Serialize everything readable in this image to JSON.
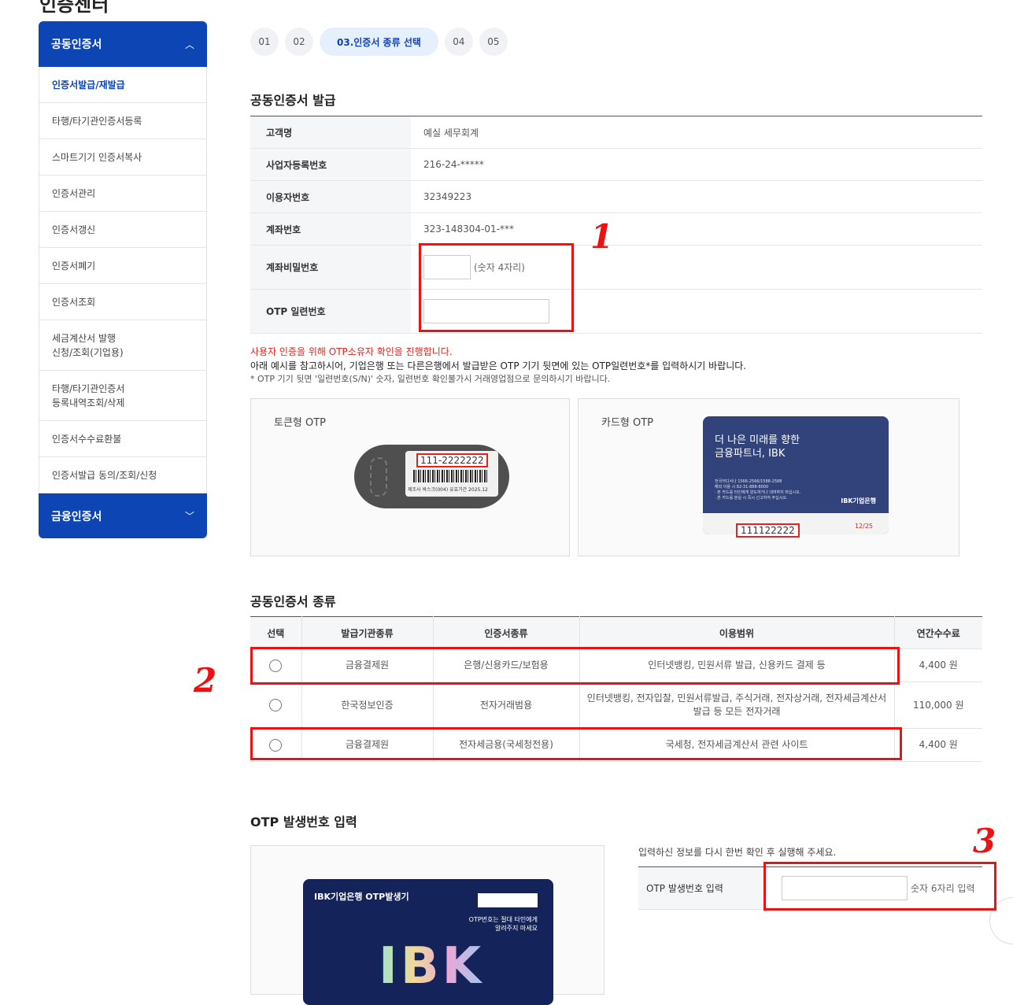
{
  "page_title": "인증센터",
  "sidebar": {
    "header": "공동인증서",
    "items": [
      {
        "label": "인증서발급/재발급",
        "active": true
      },
      {
        "label": "타행/타기관인증서등록"
      },
      {
        "label": "스마트기기 인증서복사"
      },
      {
        "label": "인증서관리"
      },
      {
        "label": "인증서갱신"
      },
      {
        "label": "인증서폐기"
      },
      {
        "label": "인증서조회"
      },
      {
        "label": "세금계산서 발행\n신청/조회(기업용)"
      },
      {
        "label": "타행/타기관인증서\n등록내역조회/삭제"
      },
      {
        "label": "인증서수수료환불"
      },
      {
        "label": "인증서발급 동의/조회/신청"
      }
    ],
    "footer": "금융인증서"
  },
  "steps": [
    "01",
    "02",
    "03.인증서 종류 선택",
    "04",
    "05"
  ],
  "issue_section": {
    "title": "공동인증서 발급",
    "rows": [
      {
        "label": "고객명",
        "value": "예실 세무회계"
      },
      {
        "label": "사업자등록번호",
        "value": "216-24-*****"
      },
      {
        "label": "이용자번호",
        "value": "32349223"
      },
      {
        "label": "계좌번호",
        "value": "323-148304-01-***"
      }
    ],
    "password_label": "계좌비밀번호",
    "password_hint": "(숫자 4자리)",
    "otp_serial_label": "OTP 일련번호"
  },
  "notice": {
    "red": "사용자 인증을 위해 OTP소유자 확인을 진행합니다.",
    "main": "아래 예시를 참고하시어, 기업은행 또는 다른은행에서 발급받은 OTP 기기 뒷면에 있는 OTP일련번호*를 입력하시기 바랍니다.",
    "small": "* OTP 기기 뒷면 '일련번호(S/N)' 숫자, 일련번호 확인불가시 거래영업점으로 문의하시기 바랍니다."
  },
  "token_otp": {
    "label": "토큰형 OTP",
    "serial": "111-2222222",
    "caption": "제조사 바스크(004) 유효기간 2025.12"
  },
  "card_otp": {
    "label": "카드형 OTP",
    "title_line1": "더 나은 미래를 향한",
    "title_line2": "금융파트너, IBK",
    "fine1": "전국어디서나 1566-2566/1588-2588",
    "fine2": "해외 이용 시 82-31-888-8000",
    "fine3": "· 본 카드를 타인에게 양도하거나 대여하지 마십시오.",
    "fine4": "· 본 카드를 분실 시 즉시 신고하여 주십시오.",
    "logo": "IBK기업은행",
    "serial": "111122222",
    "expiry": "12/25"
  },
  "cert_types": {
    "title": "공동인증서 종류",
    "headers": [
      "선택",
      "발급기관종류",
      "인증서종류",
      "이용범위",
      "연간수수료"
    ],
    "rows": [
      {
        "issuer": "금융결제원",
        "type": "은행/신용카드/보험용",
        "scope": "인터넷뱅킹, 민원서류 발급, 신용카드 결제 등",
        "fee": "4,400 원"
      },
      {
        "issuer": "한국정보인증",
        "type": "전자거래범용",
        "scope": "인터넷뱅킹, 전자입찰, 민원서류발급, 주식거래, 전자상거래, 전자세금계산서 발급 등 모든 전자거래",
        "fee": "110,000 원"
      },
      {
        "issuer": "금융결제원",
        "type": "전자세금용(국세청전용)",
        "scope": "국세청, 전자세금계산서 관련 사이트",
        "fee": "4,400 원"
      }
    ]
  },
  "otp_input": {
    "title": "OTP 발생번호 입력",
    "card_brand": "IBK기업은행 OTP발생기",
    "card_warn1": "OTP번호는 절대 타인에게",
    "card_warn2": "알려주지 마세요",
    "card_big": "IBK",
    "confirm_text": "입력하신 정보를 다시 한번 확인 후 실행해 주세요.",
    "label": "OTP 발생번호 입력",
    "hint": "숫자 6자리 입력"
  },
  "annotations": [
    "1",
    "2",
    "3"
  ],
  "colors": {
    "primary": "#0d45b5",
    "annotation": "#e11111",
    "notice_red": "#e5231b"
  }
}
